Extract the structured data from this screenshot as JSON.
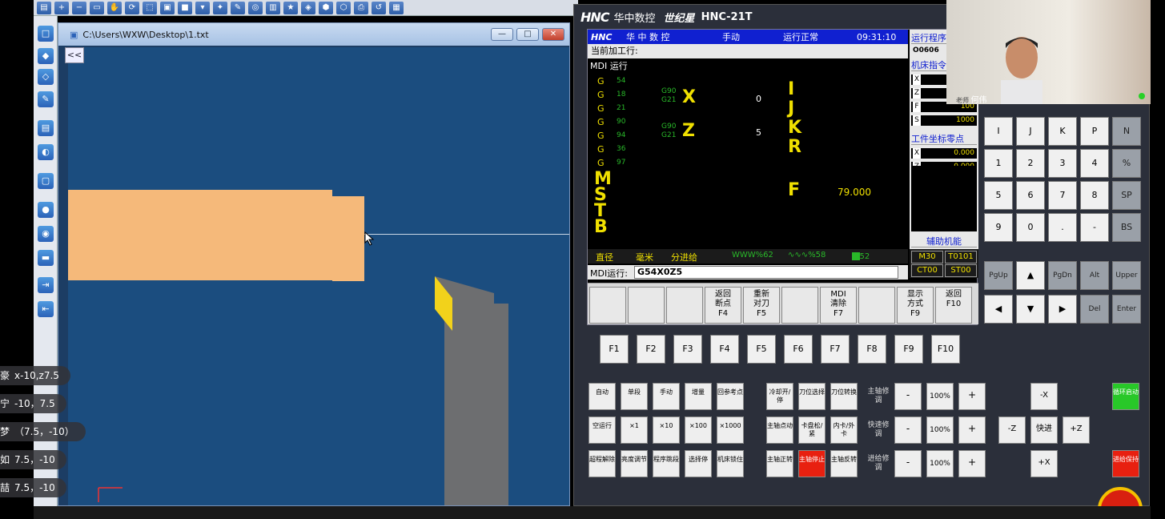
{
  "sim_window": {
    "title": "C:\\Users\\WXW\\Desktop\\1.txt",
    "collapse_label": "<<",
    "min_label": "—",
    "max_label": "□",
    "close_label": "✕"
  },
  "cnc": {
    "header_logo": "HNC",
    "header_brand": "华中数控",
    "header_series": "世纪星",
    "header_model": "HNC-21T",
    "status_logo": "HNC",
    "status_brand": "华 中 数 控",
    "mode": "手动",
    "run_status": "运行正常",
    "time": "09:31:10",
    "current_line_label": "当前加工行:",
    "mdi_title": "MDI 运行",
    "g_codes": [
      {
        "code": "G",
        "value": "54"
      },
      {
        "code": "G",
        "value": "18"
      },
      {
        "code": "G",
        "value": "21"
      },
      {
        "code": "G",
        "value": "90"
      },
      {
        "code": "G",
        "value": "94"
      },
      {
        "code": "G",
        "value": "36"
      },
      {
        "code": "G",
        "value": "97"
      }
    ],
    "x_modal": [
      "G90",
      "G21"
    ],
    "z_modal": [
      "G90",
      "G21"
    ],
    "x_label": "X",
    "z_label": "Z",
    "x_value": "0",
    "z_value": "5",
    "ijkr": [
      "I",
      "J",
      "K",
      "R"
    ],
    "mstb": [
      "M",
      "S",
      "T",
      "B"
    ],
    "f_label": "F",
    "f_value": "79.000",
    "info": {
      "hdr_program": "运行程序",
      "program_no": "O0606",
      "hdr_machine": "机床指令",
      "rows": [
        {
          "k": "X",
          "v": ""
        },
        {
          "k": "Z",
          "v": ""
        },
        {
          "k": "F",
          "v": "100"
        },
        {
          "k": "S",
          "v": "1000"
        }
      ],
      "hdr_work": "工件坐标零点",
      "work_rows": [
        {
          "k": "X",
          "v": "0.000"
        },
        {
          "k": "Z",
          "v": "0.000"
        }
      ],
      "aux_label": "辅助机能"
    },
    "mode_bar": {
      "diameter": "直径",
      "unit": "毫米",
      "feed_mode": "分进给",
      "feed_override": "WWW%62",
      "spindle_override": "∿∿∿%58",
      "rapid_override": "%52"
    },
    "right_status": [
      "M30",
      "T0101",
      "CT00",
      "ST00"
    ],
    "mdi_input_label": "MDI运行:",
    "mdi_input_value": "G54X0Z5",
    "softkeys": [
      {
        "label": "",
        "f": ""
      },
      {
        "label": "",
        "f": ""
      },
      {
        "label": "",
        "f": ""
      },
      {
        "label": "返回\n断点",
        "f": "F4"
      },
      {
        "label": "重新\n对刀",
        "f": "F5"
      },
      {
        "label": "",
        "f": ""
      },
      {
        "label": "MDI\n清除",
        "f": "F7"
      },
      {
        "label": "",
        "f": ""
      },
      {
        "label": "显示\n方式",
        "f": "F9"
      },
      {
        "label": "返回",
        "f": "F10"
      }
    ],
    "fkeys": [
      "F1",
      "F2",
      "F3",
      "F4",
      "F5",
      "F6",
      "F7",
      "F8",
      "F9",
      "F10"
    ],
    "keypad": [
      [
        "I",
        "J",
        "K",
        "P",
        "N"
      ],
      [
        "1",
        "2",
        "3",
        "4",
        "%"
      ],
      [
        "5",
        "6",
        "7",
        "8",
        "SP"
      ],
      [
        "9",
        "0",
        ".",
        "-",
        "BS"
      ],
      [
        "PgUp",
        "▲",
        "PgDn",
        "Alt",
        "Upper"
      ],
      [
        "◀",
        "▼",
        "▶",
        "Del",
        "Enter"
      ]
    ],
    "machine_row1": [
      "自动",
      "单段",
      "手动",
      "增量",
      "回参考点"
    ],
    "machine_row2": [
      "空运行",
      "×1",
      "×10",
      "×100",
      "×1000"
    ],
    "machine_row3": [
      "超程解除",
      "亮度调节",
      "程序跳段",
      "选择停",
      "机床锁住"
    ],
    "machine_col2_row1": [
      "冷却开/停",
      "刀位选择",
      "刀位转换"
    ],
    "machine_col2_row2": [
      "主轴点动",
      "卡盘松/紧",
      "内卡/外卡"
    ],
    "machine_col2_row3": [
      "主轴正转",
      "主轴停止",
      "主轴反转"
    ],
    "override_labels": [
      "主轴修调",
      "快速修调",
      "进给修调"
    ],
    "override_minus": "-",
    "override_pct": "100%",
    "override_plus": "+",
    "jog": [
      "-X",
      "-Z",
      "快进",
      "+Z",
      "+X"
    ],
    "cycle_start": "循环启动",
    "feed_hold": "进给保持"
  },
  "webcam": {
    "name_tag": "老师",
    "name_suffix": "何伟"
  },
  "chat": [
    {
      "name": "豪",
      "text": "x-10,z7.5"
    },
    {
      "name": "宁",
      "text": "-10，7.5"
    },
    {
      "name": "梦",
      "text": "（7.5，-10）"
    },
    {
      "name": "如",
      "text": "7.5，-10"
    },
    {
      "name": "喆",
      "text": "7.5，-10"
    }
  ],
  "colors": {
    "scene_bg": "#1b4d7f",
    "workpiece": "#f5b97a",
    "tool_insert": "#f2d21b",
    "status_blue": "#1020d0",
    "crt_yellow": "#f0e000",
    "crt_green": "#29b829"
  }
}
